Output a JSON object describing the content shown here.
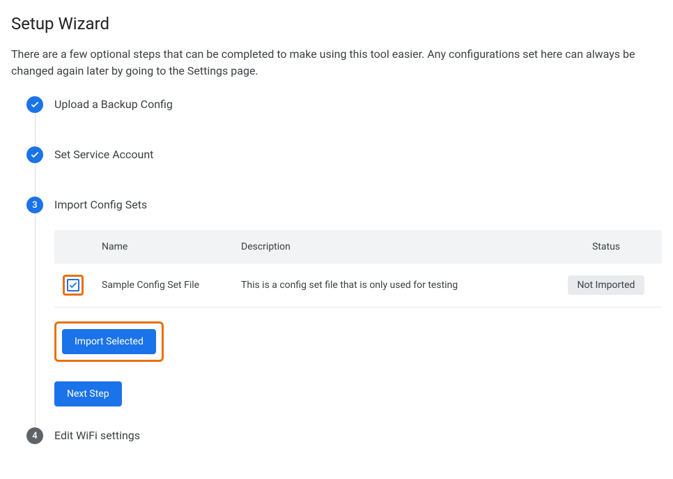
{
  "page": {
    "title": "Setup Wizard",
    "description": "There are a few optional steps that can be completed to make using this tool easier. Any configurations set here can always be changed again later by going to the Settings page."
  },
  "steps": {
    "0": {
      "status": "done",
      "title": "Upload a Backup Config"
    },
    "1": {
      "status": "done",
      "title": "Set Service Account"
    },
    "2": {
      "status": "active",
      "number": "3",
      "title": "Import Config Sets"
    },
    "3": {
      "status": "pending",
      "number": "4",
      "title": "Edit WiFi settings"
    }
  },
  "table": {
    "headers": {
      "name": "Name",
      "description": "Description",
      "status": "Status"
    },
    "rows": {
      "0": {
        "checked": true,
        "name": "Sample Config Set File",
        "description": "This is a config set file that is only used for testing",
        "status": "Not Imported"
      }
    }
  },
  "buttons": {
    "import_selected": "Import Selected",
    "next_step": "Next Step"
  }
}
